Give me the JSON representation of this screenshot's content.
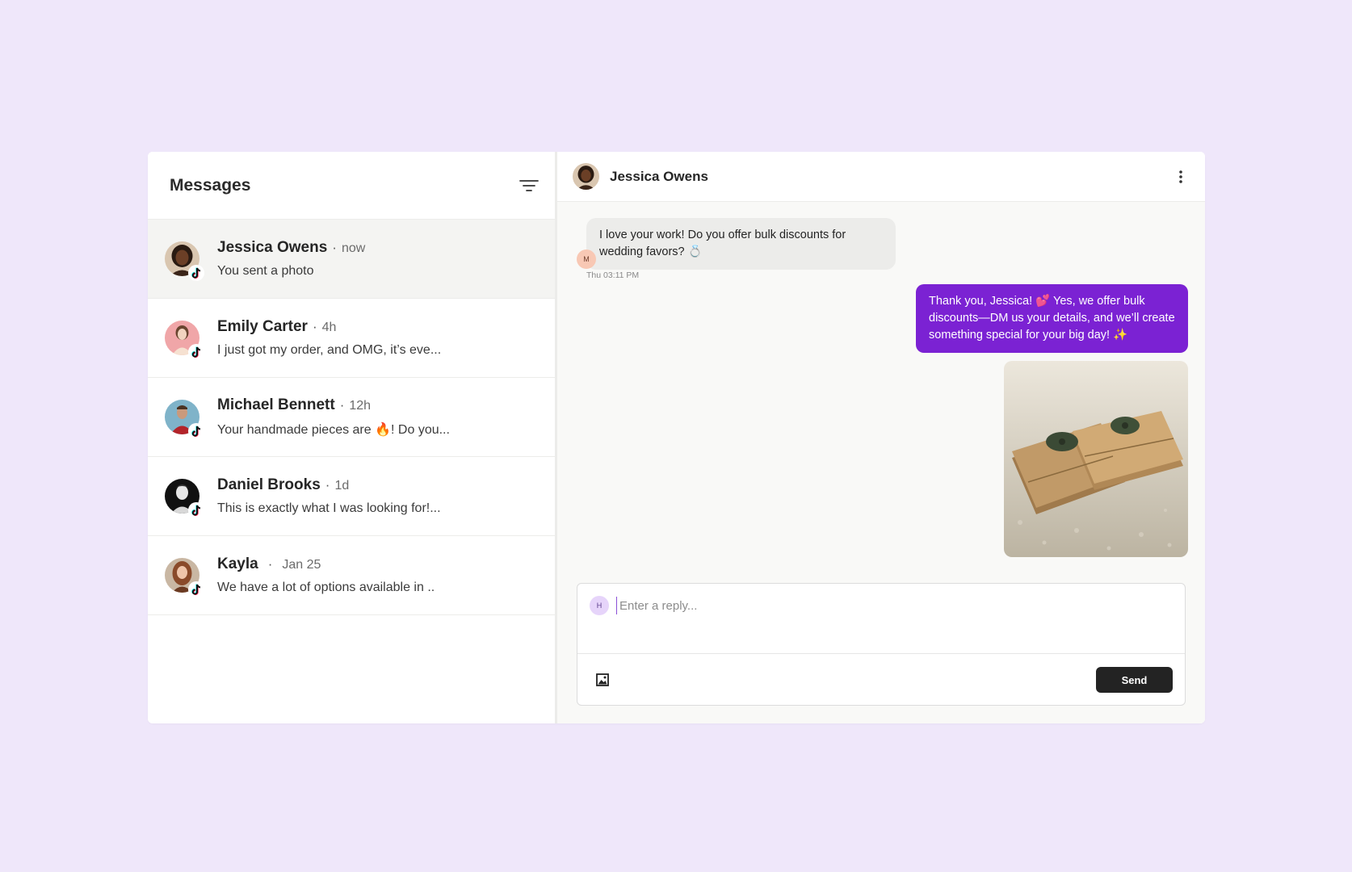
{
  "sidebar": {
    "title": "Messages",
    "conversations": [
      {
        "name": "Jessica Owens",
        "separator": "·",
        "time": "now",
        "preview": "You sent a photo",
        "active": true
      },
      {
        "name": "Emily Carter",
        "separator": "·",
        "time": "4h",
        "preview": "I just got my order, and OMG, it’s eve..."
      },
      {
        "name": "Michael Bennett",
        "separator": "·",
        "time": "12h",
        "preview": "Your handmade pieces are 🔥! Do you..."
      },
      {
        "name": "Daniel Brooks",
        "separator": "·",
        "time": "1d",
        "preview": "This is exactly what I was looking for!..."
      },
      {
        "name": "Kayla",
        "separator": "·",
        "time": "Jan 25",
        "preview": "We have a lot of options available in .."
      }
    ]
  },
  "chat": {
    "contact_name": "Jessica Owens",
    "incoming": {
      "text": "I love your work! Do you offer bulk discounts for wedding favors? 💍",
      "avatar_initial": "M",
      "timestamp": "Thu 03:11 PM"
    },
    "outgoing": {
      "text": "Thank you, Jessica! 💕 Yes, we offer bulk discounts—DM us your details, and we’ll create something special for your big day! ✨"
    }
  },
  "composer": {
    "avatar_initial": "H",
    "placeholder": "Enter a reply...",
    "send_label": "Send"
  },
  "colors": {
    "background": "#efe7fa",
    "accent": "#7b22d3",
    "send_button": "#232323"
  },
  "icons": [
    "filter-icon",
    "tiktok-icon",
    "more-vertical-icon",
    "image-icon"
  ]
}
